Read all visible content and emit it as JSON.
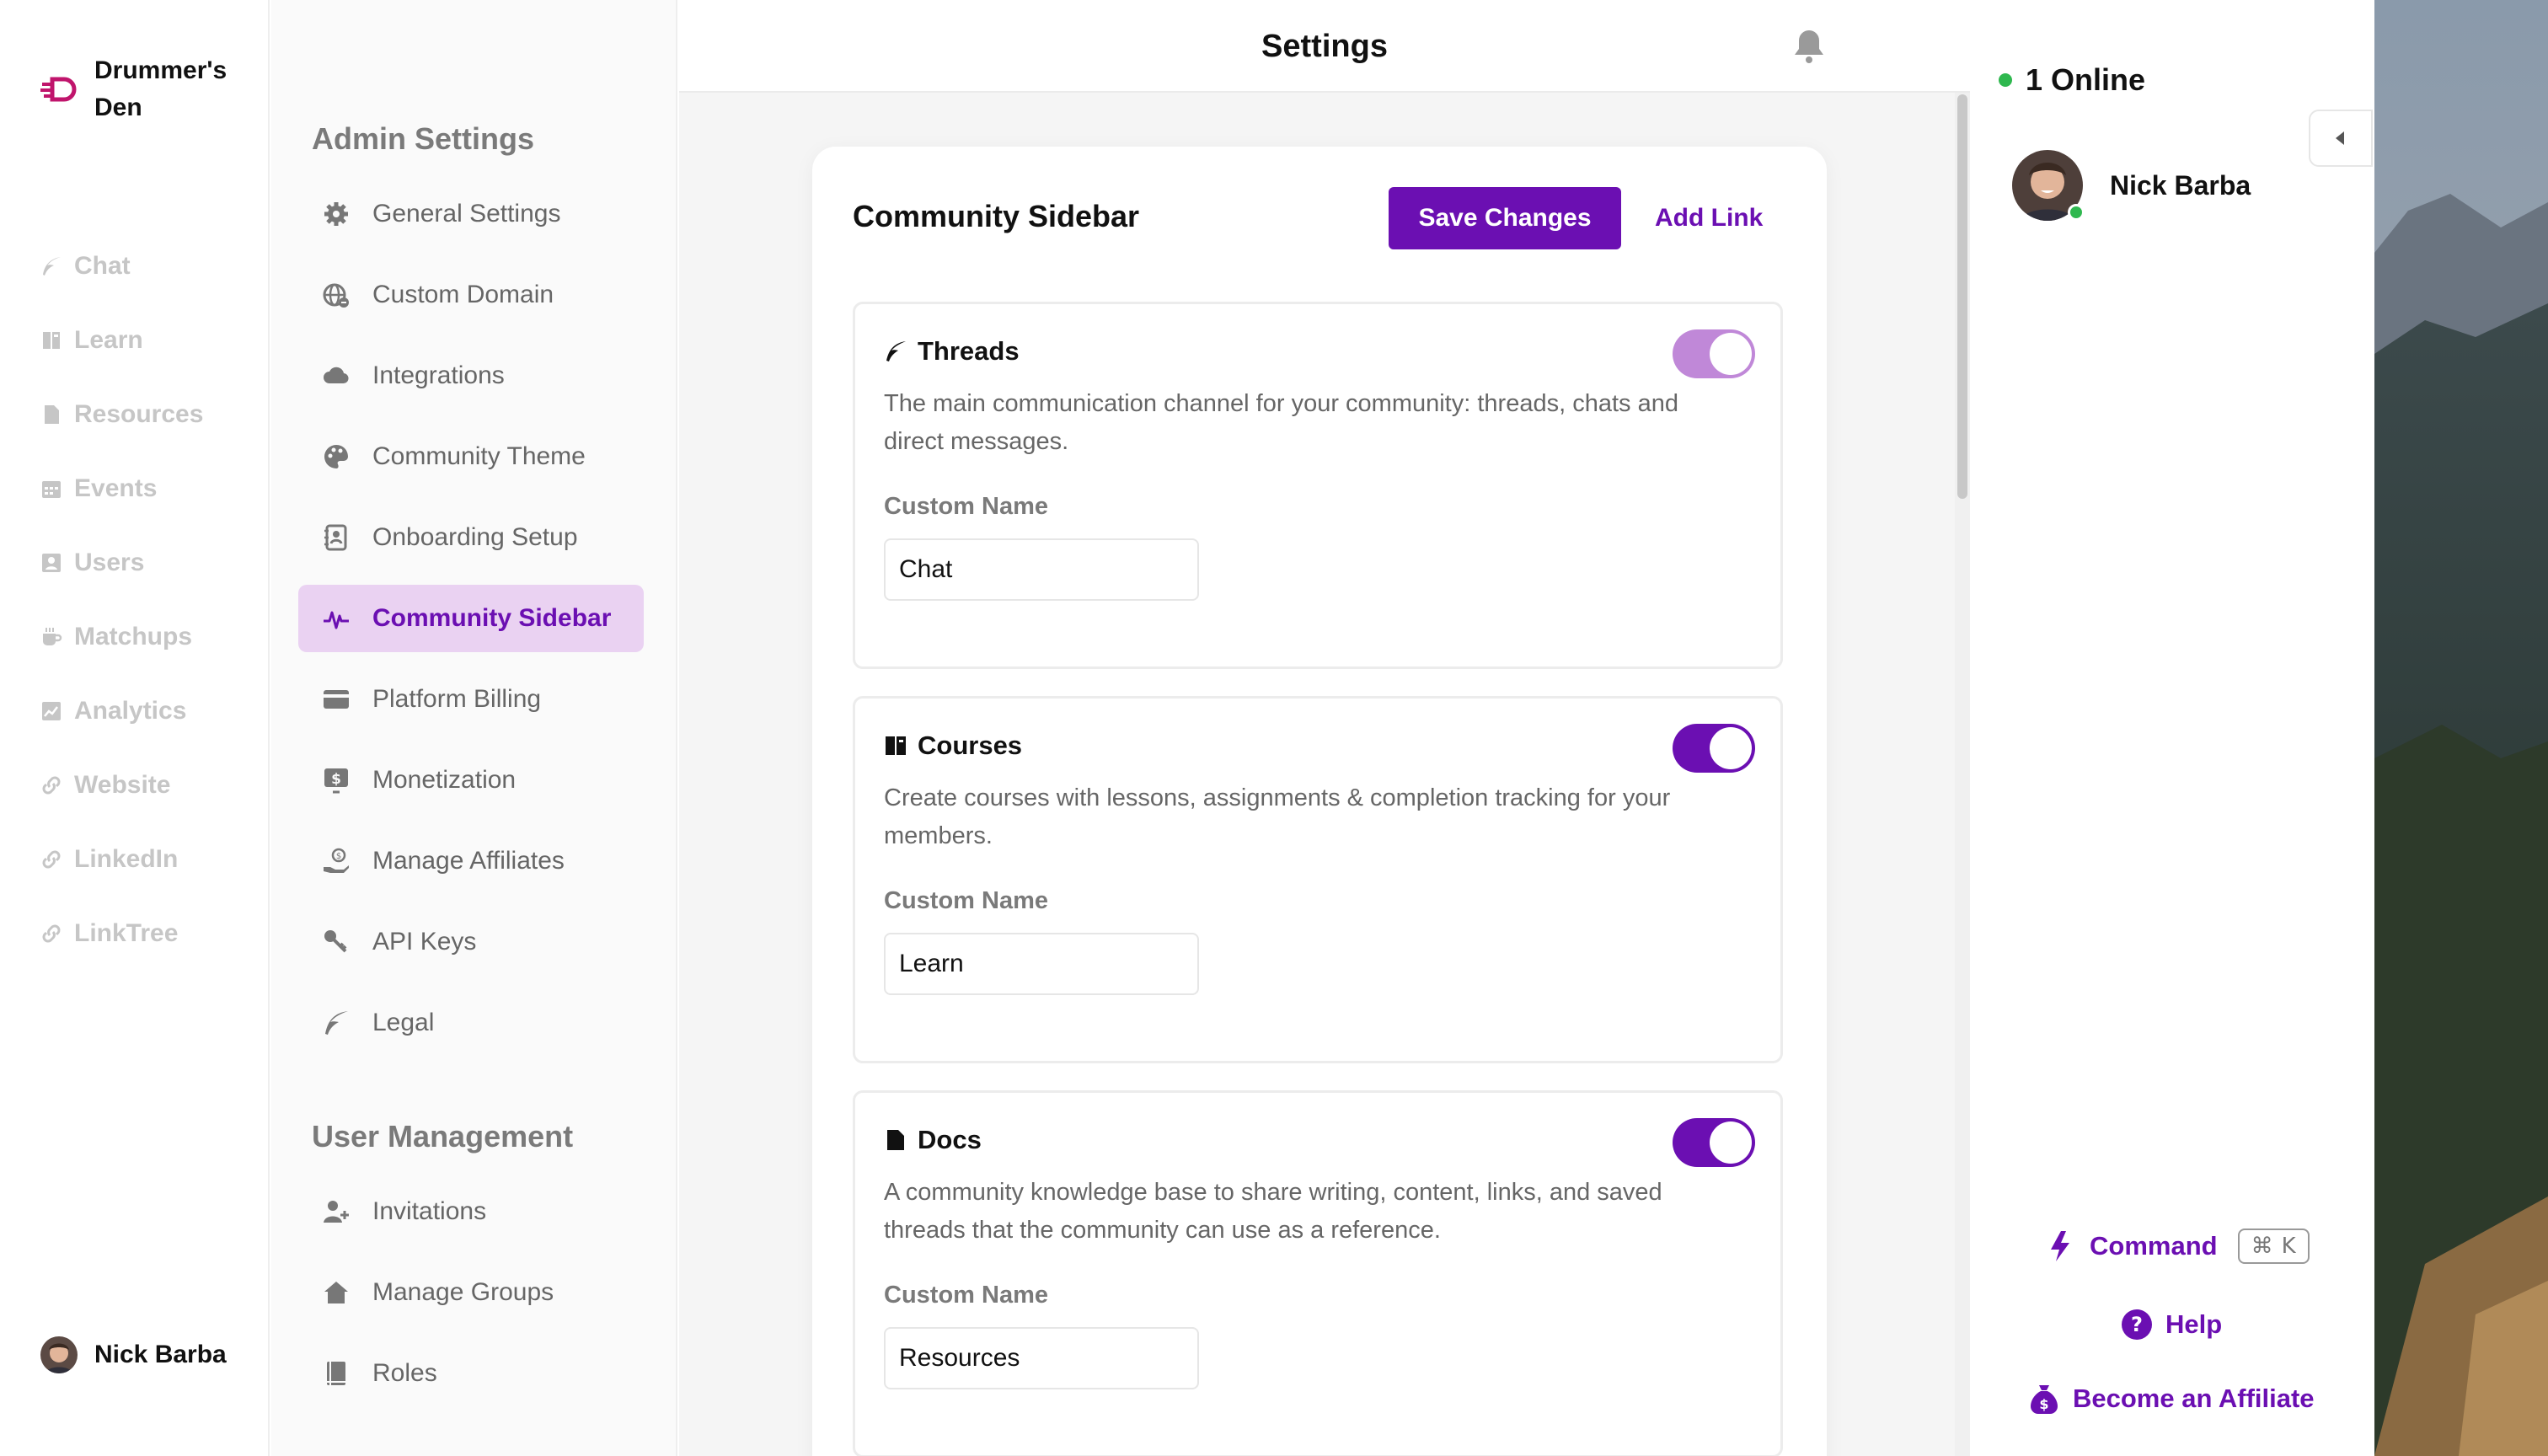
{
  "app": {
    "name": "Drummer's Den",
    "page_title": "Settings"
  },
  "community_nav": [
    {
      "label": "Chat",
      "icon": "feather-icon"
    },
    {
      "label": "Learn",
      "icon": "book-icon"
    },
    {
      "label": "Resources",
      "icon": "document-icon"
    },
    {
      "label": "Events",
      "icon": "calendar-icon"
    },
    {
      "label": "Users",
      "icon": "users-icon"
    },
    {
      "label": "Matchups",
      "icon": "coffee-icon"
    },
    {
      "label": "Analytics",
      "icon": "chart-icon"
    },
    {
      "label": "Website",
      "icon": "link-icon"
    },
    {
      "label": "LinkedIn",
      "icon": "link-icon"
    },
    {
      "label": "LinkTree",
      "icon": "link-icon"
    }
  ],
  "current_user": {
    "name": "Nick Barba"
  },
  "admin_menu": {
    "admin_heading": "Admin Settings",
    "admin_items": [
      {
        "label": "General Settings",
        "icon": "gear-icon"
      },
      {
        "label": "Custom Domain",
        "icon": "globe-icon"
      },
      {
        "label": "Integrations",
        "icon": "cloud-icon"
      },
      {
        "label": "Community Theme",
        "icon": "palette-icon"
      },
      {
        "label": "Onboarding Setup",
        "icon": "contact-book-icon"
      },
      {
        "label": "Community Sidebar",
        "icon": "pulse-icon",
        "active": true
      },
      {
        "label": "Platform Billing",
        "icon": "credit-card-icon"
      },
      {
        "label": "Monetization",
        "icon": "dollar-screen-icon"
      },
      {
        "label": "Manage Affiliates",
        "icon": "hand-coin-icon"
      },
      {
        "label": "API Keys",
        "icon": "key-icon"
      },
      {
        "label": "Legal",
        "icon": "feather-icon"
      }
    ],
    "user_heading": "User Management",
    "user_items": [
      {
        "label": "Invitations",
        "icon": "user-plus-icon"
      },
      {
        "label": "Manage Groups",
        "icon": "house-icon"
      },
      {
        "label": "Roles",
        "icon": "book-icon"
      }
    ]
  },
  "card": {
    "title": "Community Sidebar",
    "save_label": "Save Changes",
    "add_link_label": "Add Link",
    "custom_name_label": "Custom Name",
    "features": [
      {
        "name": "Threads",
        "icon": "feather-icon",
        "enabled": true,
        "description": "The main communication channel for your community: threads, chats and direct messages.",
        "custom_name": "Chat"
      },
      {
        "name": "Courses",
        "icon": "book-icon",
        "enabled": true,
        "description": "Create courses with lessons, assignments & completion tracking for your members.",
        "custom_name": "Learn"
      },
      {
        "name": "Docs",
        "icon": "document-icon",
        "enabled": true,
        "description": "A community knowledge base to share writing, content, links, and saved threads that the community can use as a reference.",
        "custom_name": "Resources"
      }
    ]
  },
  "right_panel": {
    "online_label": "1 Online",
    "members": [
      {
        "name": "Nick Barba"
      }
    ],
    "command_label": "Command",
    "command_key": "⌘",
    "command_letter": "K",
    "help_label": "Help",
    "affiliate_label": "Become an Affiliate"
  },
  "colors": {
    "accent": "#6b0fb2",
    "accent_light": "#ead2f2",
    "online": "#2fb84f",
    "muted_nav": "#c6c6c6"
  }
}
